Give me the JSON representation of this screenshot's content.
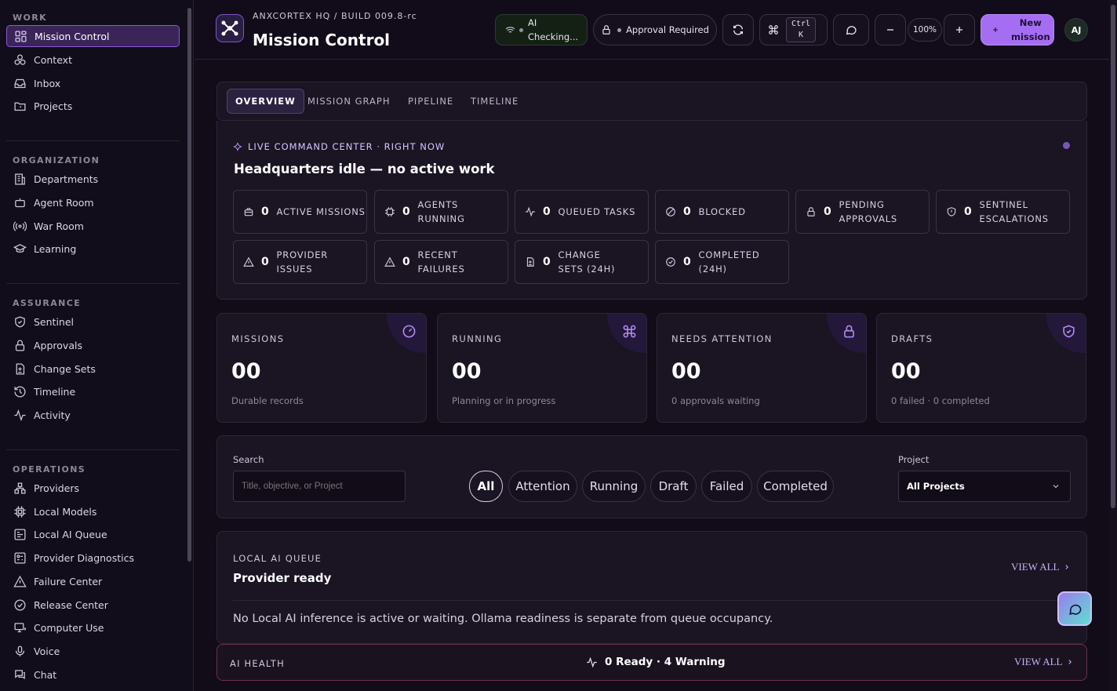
{
  "sidebar": {
    "sections": [
      {
        "title": "WORK",
        "items": [
          {
            "label": "Mission Control",
            "icon": "dashboard-icon",
            "active": true
          },
          {
            "label": "Context",
            "icon": "network-icon"
          },
          {
            "label": "Inbox",
            "icon": "inbox-icon"
          },
          {
            "label": "Projects",
            "icon": "folder-icon"
          }
        ]
      },
      {
        "title": "ORGANIZATION",
        "items": [
          {
            "label": "Departments",
            "icon": "building-icon"
          },
          {
            "label": "Agent Room",
            "icon": "robot-icon"
          },
          {
            "label": "War Room",
            "icon": "broadcast-icon"
          },
          {
            "label": "Learning",
            "icon": "graduation-cap-icon"
          }
        ]
      },
      {
        "title": "ASSURANCE",
        "items": [
          {
            "label": "Sentinel",
            "icon": "shield-check-icon"
          },
          {
            "label": "Approvals",
            "icon": "lock-icon"
          },
          {
            "label": "Change Sets",
            "icon": "file-diff-icon"
          },
          {
            "label": "Timeline",
            "icon": "history-icon"
          },
          {
            "label": "Activity",
            "icon": "activity-icon"
          }
        ]
      },
      {
        "title": "OPERATIONS",
        "items": [
          {
            "label": "Providers",
            "icon": "providers-icon"
          },
          {
            "label": "Local Models",
            "icon": "cpu-icon"
          },
          {
            "label": "Local AI Queue",
            "icon": "queue-icon"
          },
          {
            "label": "Provider Diagnostics",
            "icon": "diagnostics-icon"
          },
          {
            "label": "Failure Center",
            "icon": "warning-icon"
          },
          {
            "label": "Release Center",
            "icon": "check-circle-icon"
          },
          {
            "label": "Computer Use",
            "icon": "monitor-icon"
          },
          {
            "label": "Voice",
            "icon": "microphone-icon"
          },
          {
            "label": "Chat",
            "icon": "chat-icon"
          }
        ]
      }
    ]
  },
  "header": {
    "breadcrumb": "ANXCORTEX HQ / BUILD 009.8-rc",
    "title": "Mission Control",
    "ai_status_line1": "AI",
    "ai_status_line2": "Checking...",
    "approval_label": "Approval Required",
    "kbd_line1": "Ctrl",
    "kbd_line2": "K",
    "zoom": "100%",
    "new_mission_line1": "New",
    "new_mission_line2": "mission",
    "avatar": "AJ"
  },
  "tabs": [
    "OVERVIEW",
    "MISSION GRAPH",
    "PIPELINE",
    "TIMELINE"
  ],
  "command_center": {
    "eyebrow": "LIVE COMMAND CENTER · RIGHT NOW",
    "headline": "Headquarters idle — no active work",
    "stats": [
      {
        "value": "0",
        "label": "ACTIVE MISSIONS",
        "icon": "briefcase-icon"
      },
      {
        "value": "0",
        "label": "AGENTS RUNNING",
        "icon": "cpu-icon"
      },
      {
        "value": "0",
        "label": "QUEUED TASKS",
        "icon": "activity-icon"
      },
      {
        "value": "0",
        "label": "BLOCKED",
        "icon": "blocked-icon"
      },
      {
        "value": "0",
        "label": "PENDING APPROVALS",
        "icon": "lock-icon"
      },
      {
        "value": "0",
        "label": "SENTINEL ESCALATIONS",
        "icon": "shield-icon"
      },
      {
        "value": "0",
        "label": "PROVIDER ISSUES",
        "icon": "warning-icon"
      },
      {
        "value": "0",
        "label": "RECENT FAILURES",
        "icon": "warning-icon"
      },
      {
        "value": "0",
        "label": "CHANGE SETS (24H)",
        "icon": "file-diff-icon"
      },
      {
        "value": "0",
        "label": "COMPLETED (24H)",
        "icon": "check-circle-icon"
      }
    ]
  },
  "summary_cards": [
    {
      "title": "MISSIONS",
      "value": "00",
      "sub": "Durable records",
      "icon": "gauge-icon"
    },
    {
      "title": "RUNNING",
      "value": "00",
      "sub": "Planning or in progress",
      "icon": "command-icon"
    },
    {
      "title": "NEEDS ATTENTION",
      "value": "00",
      "sub": "0 approvals waiting",
      "icon": "lock-icon"
    },
    {
      "title": "DRAFTS",
      "value": "00",
      "sub": "0 failed · 0 completed",
      "icon": "shield-check-icon"
    }
  ],
  "filters": {
    "search_label": "Search",
    "search_placeholder": "Title, objective, or Project",
    "pills": [
      "All",
      "Attention",
      "Running",
      "Draft",
      "Failed",
      "Completed"
    ],
    "project_label": "Project",
    "project_value": "All Projects"
  },
  "local_queue": {
    "eyebrow": "LOCAL AI QUEUE",
    "title": "Provider ready",
    "view_all": "VIEW ALL",
    "message": "No Local AI inference is active or waiting. Ollama readiness is separate from queue occupancy."
  },
  "ai_health": {
    "eyebrow": "AI HEALTH",
    "summary": "0 Ready · 4 Warning",
    "view_all": "VIEW ALL"
  },
  "colors": {
    "accent": "#a46ef0",
    "background": "#110c18",
    "panel": "#1a1423",
    "warning_border": "#6a2f50"
  }
}
